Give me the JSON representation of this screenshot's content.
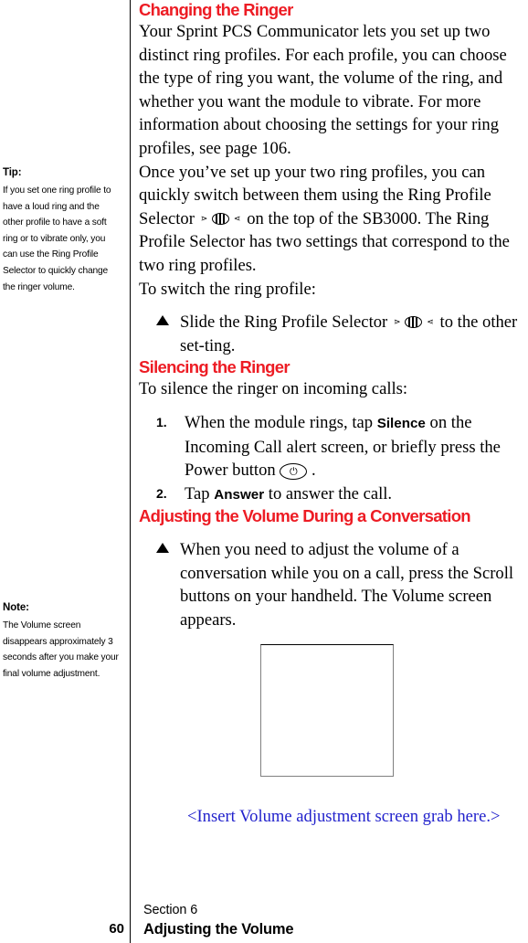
{
  "page": {
    "number": "60",
    "section_label": "Section 6",
    "running_title": "Adjusting the Volume"
  },
  "sidebar": {
    "notes": [
      {
        "title": "Tip:",
        "body": "If you set one ring profile to have a loud ring and the other profile to have a soft ring or to vibrate only, you can use the Ring Profile Selector to quickly change the ringer volume."
      },
      {
        "title": "Note:",
        "body": "The Volume screen disappears approximately 3 seconds after you make your final volume adjustment."
      }
    ]
  },
  "main": {
    "heading_color": "#ED1C24",
    "caption_color": "#2222CC",
    "sections": [
      {
        "heading": "Changing the Ringer",
        "paragraph_1": "Your Sprint PCS Communicator lets you set up two distinct ring profiles. For each profile, you can choose the type of ring you want, the volume of the ring, and whether you want the module to vibrate. For more information about choosing the settings for your ring profiles, see page 106.",
        "paragraph_2a": "Once you’ve set up your two ring profiles, you can quickly switch between them using the Ring Profile Selector",
        "paragraph_2b": "on the top of the SB3000. The Ring Profile Selector has two settings that correspond to the two ring profiles.",
        "paragraph_3": "To switch the ring profile:",
        "bullet_a": "Slide the Ring Profile Selector",
        "bullet_b": "to the other set-ting."
      },
      {
        "heading": "Silencing the Ringer",
        "intro": "To silence the ringer on incoming calls:",
        "steps": [
          {
            "number": "1.",
            "text_a": "When the module rings, tap",
            "emphasis": "Silence",
            "text_b": "on the Incoming Call alert screen, or briefly press the Power button",
            "text_c": "."
          },
          {
            "number": "2.",
            "text_a": "Tap",
            "emphasis": "Answer",
            "text_b": "to answer the call."
          }
        ]
      },
      {
        "heading": "Adjusting the Volume During a Conversation",
        "bullet": "When you need to adjust the volume of a conversation while you on a call, press the Scroll buttons on your handheld. The Volume screen appears."
      }
    ],
    "figure_caption": "<Insert Volume adjustment screen grab here.>"
  },
  "icons": {
    "ring_profile_selector": "ring-profile-selector-icon",
    "power_button": "power-button-icon",
    "arrow_left": "⋖",
    "arrow_right": "⋗",
    "power_glyph": "⏻"
  }
}
